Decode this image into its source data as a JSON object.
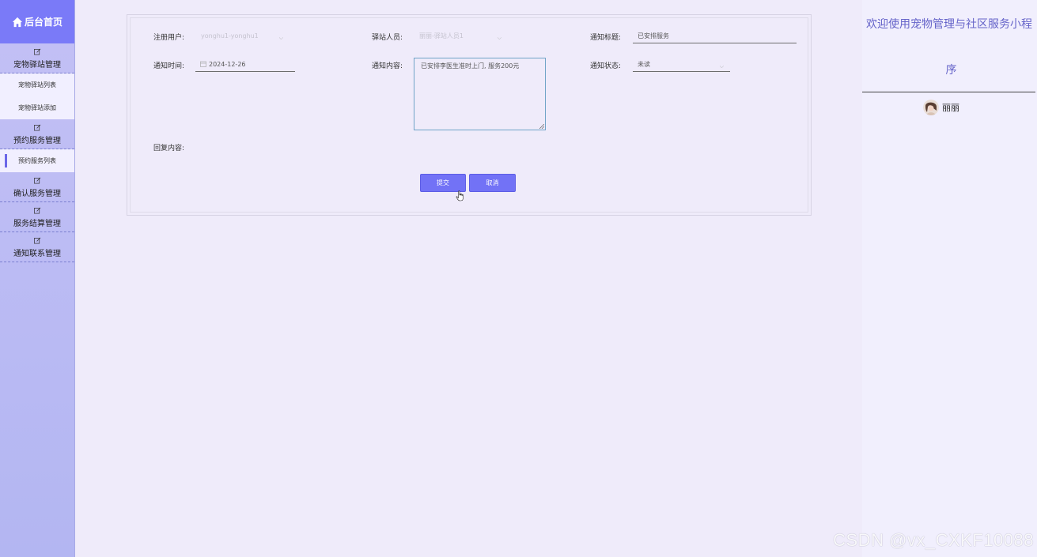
{
  "sidebar": {
    "home_label": "后台首页",
    "groups": [
      {
        "label": "宠物驿站管理",
        "subs": [
          "宠物驿站列表",
          "宠物驿站添加"
        ]
      },
      {
        "label": "预约服务管理",
        "subs": [
          "预约服务列表"
        ]
      },
      {
        "label": "确认服务管理",
        "subs": []
      },
      {
        "label": "服务结算管理",
        "subs": []
      },
      {
        "label": "通知联系管理",
        "subs": []
      }
    ]
  },
  "form": {
    "user_label": "注册用户:",
    "user_value": "yonghu1-yonghu1",
    "staff_label": "驿站人员:",
    "staff_value": "丽丽-驿站人员1",
    "title_label": "通知标题:",
    "title_value": "已安排服务",
    "time_label": "通知时间:",
    "time_value": "2024-12-26",
    "content_label": "通知内容:",
    "content_value": "已安排李医生准时上门, 服务200元",
    "status_label": "通知状态:",
    "status_value": "未读",
    "reply_label": "回复内容:",
    "submit_label": "提交",
    "cancel_label": "取消"
  },
  "header": {
    "welcome_line1": "欢迎使用宠物管理与社区服务小程",
    "welcome_line2": "序",
    "username": "丽丽"
  },
  "watermark": "CSDN @vx_CXKF10088",
  "colors": {
    "accent": "#7272f6",
    "sidebar_home": "#7a7af8",
    "page_bg": "#efebfa",
    "welcome_text": "#6563c9"
  }
}
